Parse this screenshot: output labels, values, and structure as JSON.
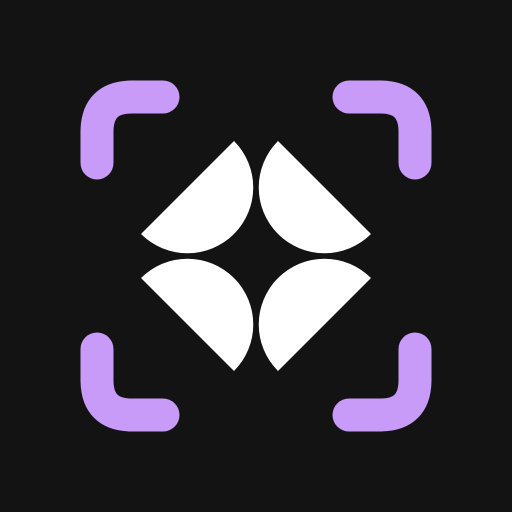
{
  "icon": {
    "name": "scan-sparkle-icon",
    "colors": {
      "background": "#131313",
      "frame": "#c79bf7",
      "symbol": "#ffffff"
    }
  }
}
